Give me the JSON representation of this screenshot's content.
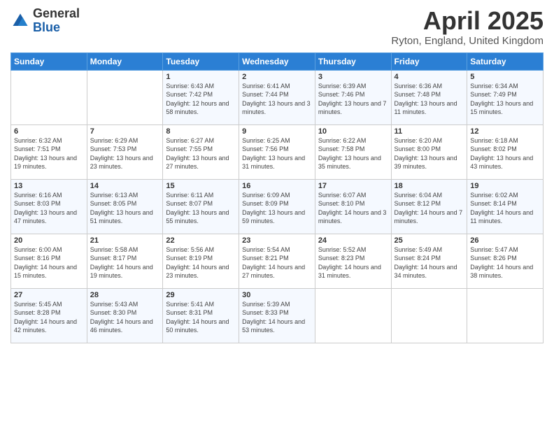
{
  "header": {
    "logo_general": "General",
    "logo_blue": "Blue",
    "title": "April 2025",
    "subtitle": "Ryton, England, United Kingdom"
  },
  "calendar": {
    "days_of_week": [
      "Sunday",
      "Monday",
      "Tuesday",
      "Wednesday",
      "Thursday",
      "Friday",
      "Saturday"
    ],
    "weeks": [
      [
        {
          "day": "",
          "sunrise": "",
          "sunset": "",
          "daylight": ""
        },
        {
          "day": "",
          "sunrise": "",
          "sunset": "",
          "daylight": ""
        },
        {
          "day": "1",
          "sunrise": "Sunrise: 6:43 AM",
          "sunset": "Sunset: 7:42 PM",
          "daylight": "Daylight: 12 hours and 58 minutes."
        },
        {
          "day": "2",
          "sunrise": "Sunrise: 6:41 AM",
          "sunset": "Sunset: 7:44 PM",
          "daylight": "Daylight: 13 hours and 3 minutes."
        },
        {
          "day": "3",
          "sunrise": "Sunrise: 6:39 AM",
          "sunset": "Sunset: 7:46 PM",
          "daylight": "Daylight: 13 hours and 7 minutes."
        },
        {
          "day": "4",
          "sunrise": "Sunrise: 6:36 AM",
          "sunset": "Sunset: 7:48 PM",
          "daylight": "Daylight: 13 hours and 11 minutes."
        },
        {
          "day": "5",
          "sunrise": "Sunrise: 6:34 AM",
          "sunset": "Sunset: 7:49 PM",
          "daylight": "Daylight: 13 hours and 15 minutes."
        }
      ],
      [
        {
          "day": "6",
          "sunrise": "Sunrise: 6:32 AM",
          "sunset": "Sunset: 7:51 PM",
          "daylight": "Daylight: 13 hours and 19 minutes."
        },
        {
          "day": "7",
          "sunrise": "Sunrise: 6:29 AM",
          "sunset": "Sunset: 7:53 PM",
          "daylight": "Daylight: 13 hours and 23 minutes."
        },
        {
          "day": "8",
          "sunrise": "Sunrise: 6:27 AM",
          "sunset": "Sunset: 7:55 PM",
          "daylight": "Daylight: 13 hours and 27 minutes."
        },
        {
          "day": "9",
          "sunrise": "Sunrise: 6:25 AM",
          "sunset": "Sunset: 7:56 PM",
          "daylight": "Daylight: 13 hours and 31 minutes."
        },
        {
          "day": "10",
          "sunrise": "Sunrise: 6:22 AM",
          "sunset": "Sunset: 7:58 PM",
          "daylight": "Daylight: 13 hours and 35 minutes."
        },
        {
          "day": "11",
          "sunrise": "Sunrise: 6:20 AM",
          "sunset": "Sunset: 8:00 PM",
          "daylight": "Daylight: 13 hours and 39 minutes."
        },
        {
          "day": "12",
          "sunrise": "Sunrise: 6:18 AM",
          "sunset": "Sunset: 8:02 PM",
          "daylight": "Daylight: 13 hours and 43 minutes."
        }
      ],
      [
        {
          "day": "13",
          "sunrise": "Sunrise: 6:16 AM",
          "sunset": "Sunset: 8:03 PM",
          "daylight": "Daylight: 13 hours and 47 minutes."
        },
        {
          "day": "14",
          "sunrise": "Sunrise: 6:13 AM",
          "sunset": "Sunset: 8:05 PM",
          "daylight": "Daylight: 13 hours and 51 minutes."
        },
        {
          "day": "15",
          "sunrise": "Sunrise: 6:11 AM",
          "sunset": "Sunset: 8:07 PM",
          "daylight": "Daylight: 13 hours and 55 minutes."
        },
        {
          "day": "16",
          "sunrise": "Sunrise: 6:09 AM",
          "sunset": "Sunset: 8:09 PM",
          "daylight": "Daylight: 13 hours and 59 minutes."
        },
        {
          "day": "17",
          "sunrise": "Sunrise: 6:07 AM",
          "sunset": "Sunset: 8:10 PM",
          "daylight": "Daylight: 14 hours and 3 minutes."
        },
        {
          "day": "18",
          "sunrise": "Sunrise: 6:04 AM",
          "sunset": "Sunset: 8:12 PM",
          "daylight": "Daylight: 14 hours and 7 minutes."
        },
        {
          "day": "19",
          "sunrise": "Sunrise: 6:02 AM",
          "sunset": "Sunset: 8:14 PM",
          "daylight": "Daylight: 14 hours and 11 minutes."
        }
      ],
      [
        {
          "day": "20",
          "sunrise": "Sunrise: 6:00 AM",
          "sunset": "Sunset: 8:16 PM",
          "daylight": "Daylight: 14 hours and 15 minutes."
        },
        {
          "day": "21",
          "sunrise": "Sunrise: 5:58 AM",
          "sunset": "Sunset: 8:17 PM",
          "daylight": "Daylight: 14 hours and 19 minutes."
        },
        {
          "day": "22",
          "sunrise": "Sunrise: 5:56 AM",
          "sunset": "Sunset: 8:19 PM",
          "daylight": "Daylight: 14 hours and 23 minutes."
        },
        {
          "day": "23",
          "sunrise": "Sunrise: 5:54 AM",
          "sunset": "Sunset: 8:21 PM",
          "daylight": "Daylight: 14 hours and 27 minutes."
        },
        {
          "day": "24",
          "sunrise": "Sunrise: 5:52 AM",
          "sunset": "Sunset: 8:23 PM",
          "daylight": "Daylight: 14 hours and 31 minutes."
        },
        {
          "day": "25",
          "sunrise": "Sunrise: 5:49 AM",
          "sunset": "Sunset: 8:24 PM",
          "daylight": "Daylight: 14 hours and 34 minutes."
        },
        {
          "day": "26",
          "sunrise": "Sunrise: 5:47 AM",
          "sunset": "Sunset: 8:26 PM",
          "daylight": "Daylight: 14 hours and 38 minutes."
        }
      ],
      [
        {
          "day": "27",
          "sunrise": "Sunrise: 5:45 AM",
          "sunset": "Sunset: 8:28 PM",
          "daylight": "Daylight: 14 hours and 42 minutes."
        },
        {
          "day": "28",
          "sunrise": "Sunrise: 5:43 AM",
          "sunset": "Sunset: 8:30 PM",
          "daylight": "Daylight: 14 hours and 46 minutes."
        },
        {
          "day": "29",
          "sunrise": "Sunrise: 5:41 AM",
          "sunset": "Sunset: 8:31 PM",
          "daylight": "Daylight: 14 hours and 50 minutes."
        },
        {
          "day": "30",
          "sunrise": "Sunrise: 5:39 AM",
          "sunset": "Sunset: 8:33 PM",
          "daylight": "Daylight: 14 hours and 53 minutes."
        },
        {
          "day": "",
          "sunrise": "",
          "sunset": "",
          "daylight": ""
        },
        {
          "day": "",
          "sunrise": "",
          "sunset": "",
          "daylight": ""
        },
        {
          "day": "",
          "sunrise": "",
          "sunset": "",
          "daylight": ""
        }
      ]
    ]
  }
}
